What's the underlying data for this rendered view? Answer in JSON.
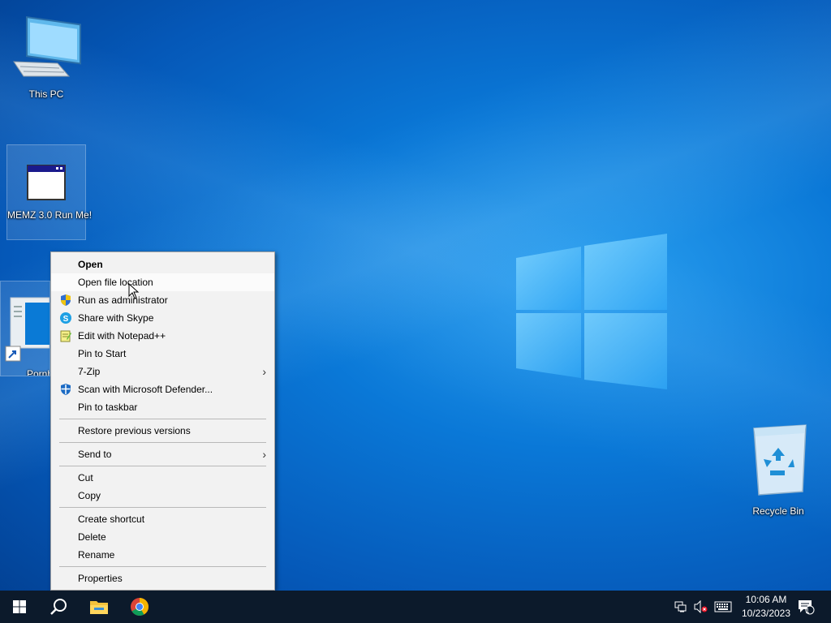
{
  "desktop": {
    "icons": [
      {
        "label": "This PC",
        "icon": "computer-icon"
      },
      {
        "label": "MEMZ 3.0 Run Me!",
        "icon": "window-app-icon"
      },
      {
        "label": "Pornh",
        "icon": "app-shortcut-icon"
      },
      {
        "label": "Recycle Bin",
        "icon": "recycle-bin-icon"
      }
    ]
  },
  "context_menu": {
    "items": {
      "open": "Open",
      "open_file_location": "Open file location",
      "run_as_admin": "Run as administrator",
      "share_skype": "Share with Skype",
      "edit_notepad": "Edit with Notepad++",
      "pin_start": "Pin to Start",
      "seven_zip": "7-Zip",
      "scan_defender": "Scan with Microsoft Defender...",
      "pin_taskbar": "Pin to taskbar",
      "restore_versions": "Restore previous versions",
      "send_to": "Send to",
      "cut": "Cut",
      "copy": "Copy",
      "create_shortcut": "Create shortcut",
      "delete": "Delete",
      "rename": "Rename",
      "properties": "Properties"
    }
  },
  "taskbar": {
    "apps": [
      "start-icon",
      "search-icon",
      "file-explorer-icon",
      "chrome-icon"
    ],
    "clock": {
      "time": "10:06 AM",
      "date": "10/23/2023"
    },
    "notification_count": "1"
  },
  "colors": {
    "taskbar": "#0c1a2b",
    "menu_bg": "#f2f2f2",
    "accent": "#0a78d7"
  }
}
